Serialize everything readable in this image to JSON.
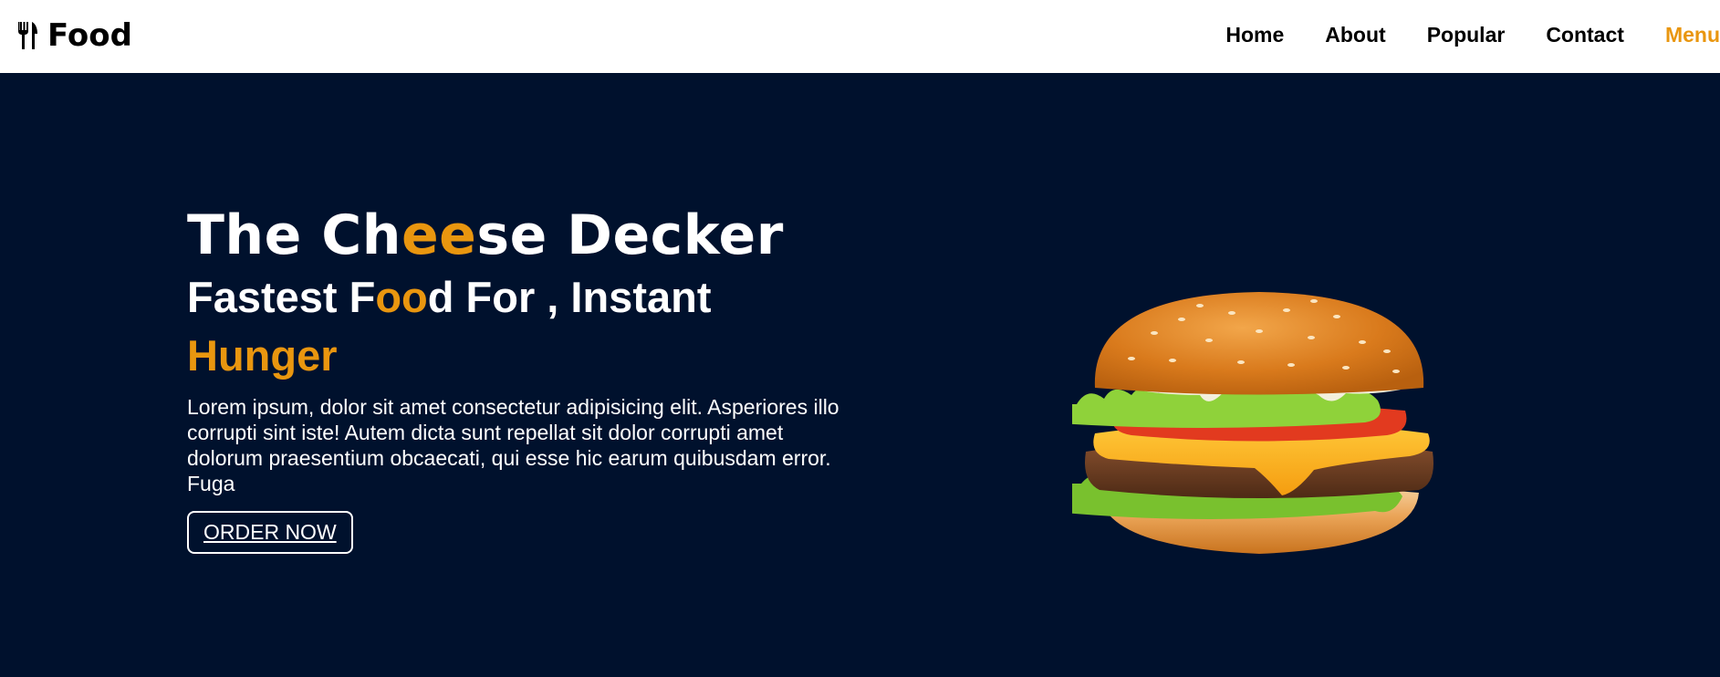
{
  "brand": {
    "name": "Food",
    "icon": "utensils-icon"
  },
  "nav": {
    "items": [
      "Home",
      "About",
      "Popular",
      "Contact",
      "Menu"
    ],
    "active": "Menu"
  },
  "hero": {
    "title_parts": [
      "The Ch",
      "ee",
      "se Decker"
    ],
    "subtitle_parts": [
      "Fastest F",
      "oo",
      "d For , Instant "
    ],
    "subtitle_highlight": "Hunger",
    "description": "Lorem ipsum, dolor sit amet consectetur adipisicing elit. Asperiores illo corrupti sint iste! Autem dicta sunt repellat sit dolor corrupti amet dolorum praesentium obcaecati, qui esse hic earum quibusdam error. Fuga",
    "cta_label": "ORDER NOW",
    "image": "cheeseburger-image"
  },
  "colors": {
    "accent": "#e9960f",
    "background": "#00112d",
    "nav_bg": "#ffffff"
  }
}
